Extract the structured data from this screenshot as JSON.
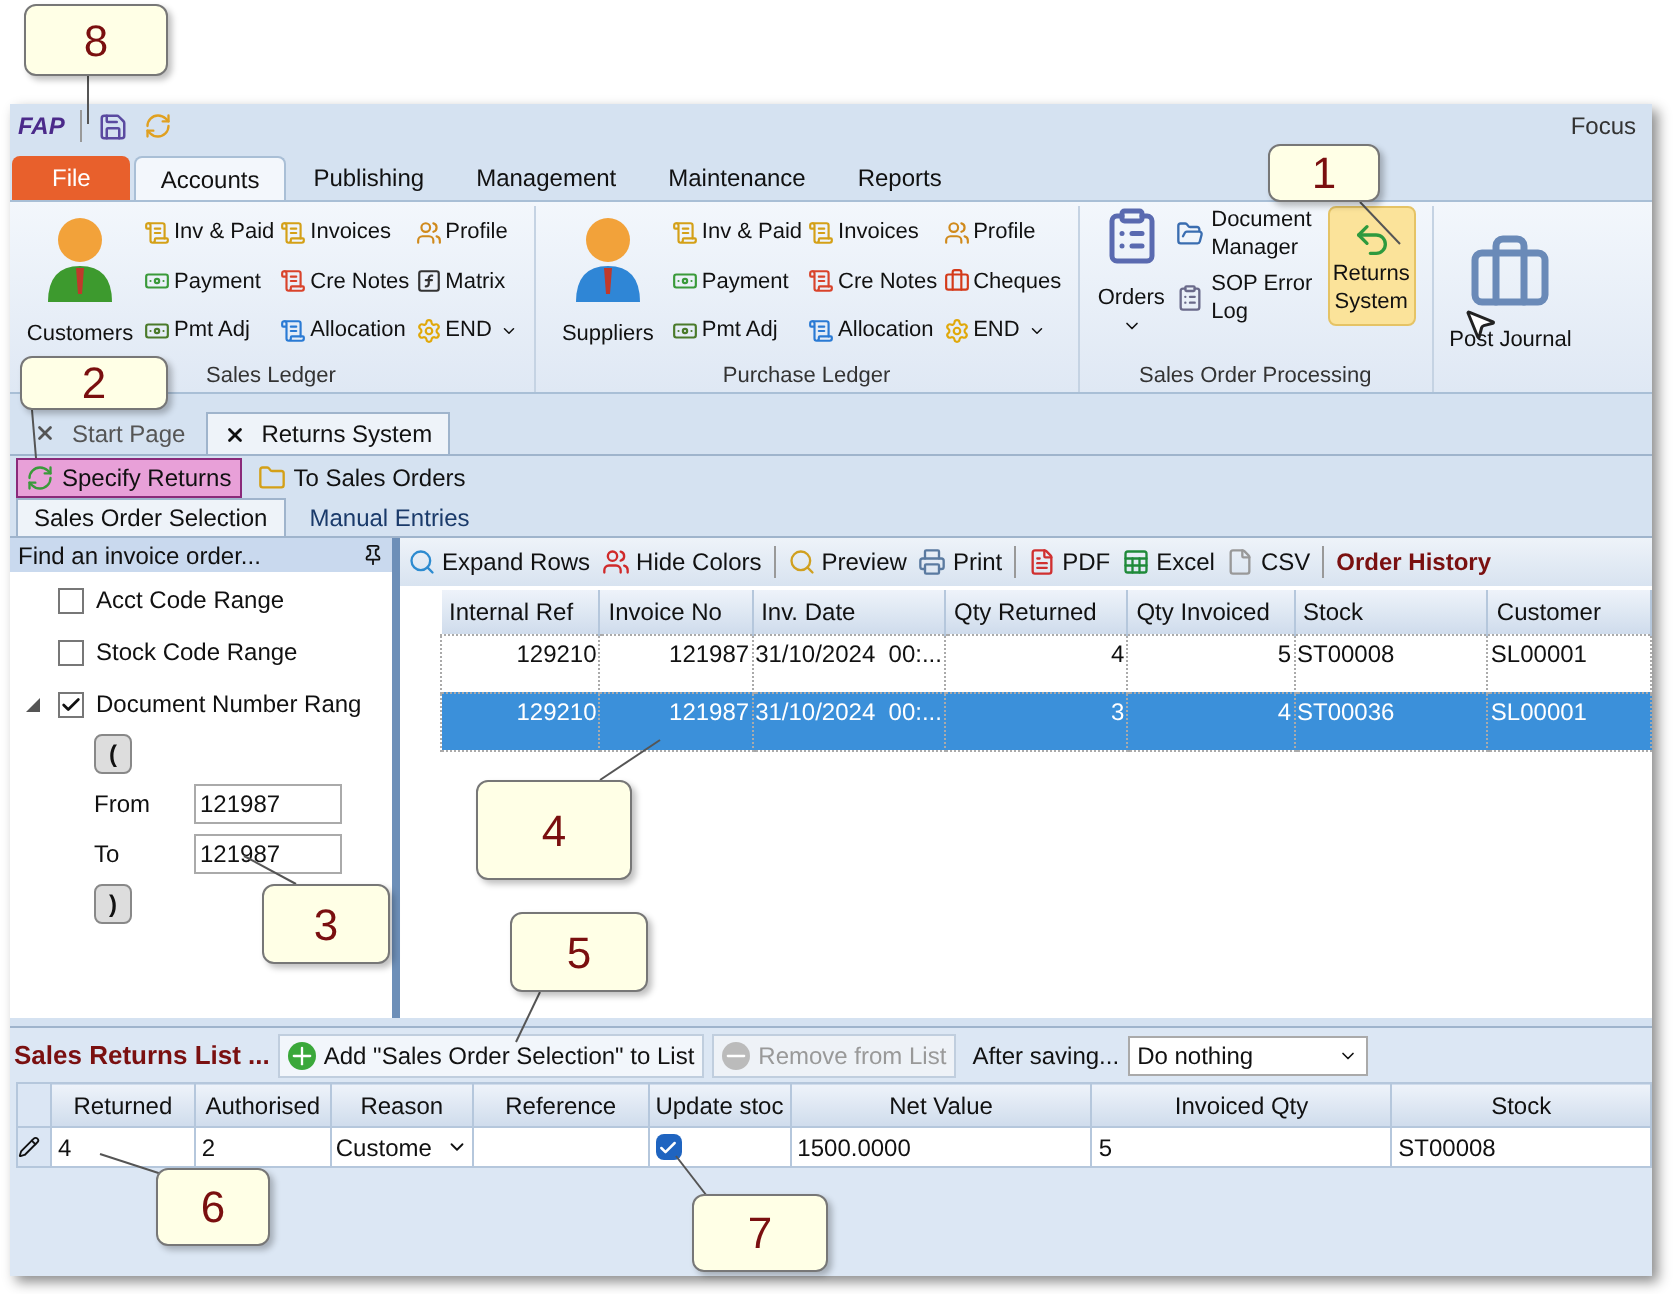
{
  "app_logo": "FAP",
  "window": {
    "title": "Focus"
  },
  "ribbon_tabs": [
    {
      "label": "File",
      "kind": "file",
      "selected": false
    },
    {
      "label": "Accounts",
      "kind": "tab",
      "selected": true
    },
    {
      "label": "Publishing",
      "kind": "tab",
      "selected": false
    },
    {
      "label": "Management",
      "kind": "tab",
      "selected": false
    },
    {
      "label": "Maintenance",
      "kind": "tab",
      "selected": false
    },
    {
      "label": "Reports",
      "kind": "tab",
      "selected": false
    }
  ],
  "ledger_groups": [
    {
      "label": "Sales Ledger",
      "large": "Customers",
      "kind": "sales",
      "items": [
        {
          "label": "Inv & Paid",
          "dropdown": false
        },
        {
          "label": "Payment",
          "dropdown": false
        },
        {
          "label": "Pmt Adj",
          "dropdown": false
        },
        {
          "label": "Invoices",
          "dropdown": false
        },
        {
          "label": "Cre Notes",
          "dropdown": false
        },
        {
          "label": "Allocation",
          "dropdown": false
        },
        {
          "label": "Profile",
          "dropdown": false
        },
        {
          "label": "Matrix",
          "dropdown": false
        },
        {
          "label": "END",
          "dropdown": true
        }
      ]
    },
    {
      "label": "Purchase Ledger",
      "large": "Suppliers",
      "kind": "purchase",
      "items": [
        {
          "label": "Inv & Paid",
          "dropdown": false
        },
        {
          "label": "Payment",
          "dropdown": false
        },
        {
          "label": "Pmt Adj",
          "dropdown": false
        },
        {
          "label": "Invoices",
          "dropdown": false
        },
        {
          "label": "Cre Notes",
          "dropdown": false
        },
        {
          "label": "Allocation",
          "dropdown": false
        },
        {
          "label": "Profile",
          "dropdown": false
        },
        {
          "label": "Cheques",
          "dropdown": false
        },
        {
          "label": "END",
          "dropdown": true
        }
      ]
    }
  ],
  "sop_group": {
    "label": "Sales Order Processing",
    "orders": {
      "label": "Orders",
      "selected": false
    },
    "items": [
      {
        "label": "Document Manager",
        "selected": false
      },
      {
        "label": "SOP Error Log",
        "selected": false
      }
    ],
    "returns": {
      "label": "Returns System",
      "selected": true
    }
  },
  "post_journal": {
    "label": "Post Journal"
  },
  "doc_tabs": [
    {
      "label": "Start Page",
      "selected": false
    },
    {
      "label": "Returns System",
      "selected": true
    }
  ],
  "toolbar": [
    {
      "label": "Specify Returns",
      "selected": true
    },
    {
      "label": "To Sales Orders",
      "selected": false
    }
  ],
  "sub_tabs": [
    {
      "label": "Sales Order Selection",
      "selected": true
    },
    {
      "label": "Manual Entries",
      "selected": false
    }
  ],
  "finder": {
    "title": "Find an invoice order...",
    "filters": [
      {
        "label": "Acct Code Range",
        "checked": false,
        "expanded": false
      },
      {
        "label": "Stock Code Range",
        "checked": false,
        "expanded": false
      },
      {
        "label": "Document Number Rang",
        "checked": true,
        "expanded": true,
        "children": {
          "open_bracket": "(",
          "from": {
            "label": "From",
            "value": "121987"
          },
          "to": {
            "label": "To",
            "value": "121987"
          },
          "close_bracket": ")"
        }
      }
    ]
  },
  "grid_toolbar": {
    "buttons": [
      "Expand Rows",
      "Hide Colors",
      "Preview",
      "Print",
      "PDF",
      "Excel",
      "CSV"
    ],
    "title": "Order History"
  },
  "orders_table": {
    "columns": [
      "Internal Ref",
      "Invoice No",
      "Inv. Date",
      "Qty Returned",
      "Qty Invoiced",
      "Stock",
      "Customer"
    ],
    "rows": [
      {
        "selected": false,
        "cells": [
          "129210",
          "121987",
          "31/10/2024  00:...",
          "4",
          "5",
          "ST00008",
          "SL00001"
        ]
      },
      {
        "selected": true,
        "cells": [
          "129210",
          "121987",
          "31/10/2024  00:...",
          "3",
          "4",
          "ST00036",
          "SL00001"
        ]
      }
    ]
  },
  "returns_list": {
    "title": "Sales Returns List ...",
    "add_button": {
      "label": "Add \"Sales Order Selection\" to List",
      "disabled": false
    },
    "remove_button": {
      "label": "Remove from List",
      "disabled": true
    },
    "after_saving": {
      "label": "After saving...",
      "value": "Do nothing"
    },
    "columns": [
      "Returned",
      "Authorised",
      "Reason",
      "Reference",
      "Update stoc",
      "Net Value",
      "Invoiced Qty",
      "Stock"
    ],
    "row": {
      "returned": "4",
      "authorised": "2",
      "reason": "Custome",
      "update_stock": true,
      "net_value": "1500.0000",
      "invoiced_qty": "5",
      "stock": "ST00008"
    }
  },
  "callouts": [
    "1",
    "2",
    "3",
    "4",
    "5",
    "6",
    "7",
    "8"
  ]
}
